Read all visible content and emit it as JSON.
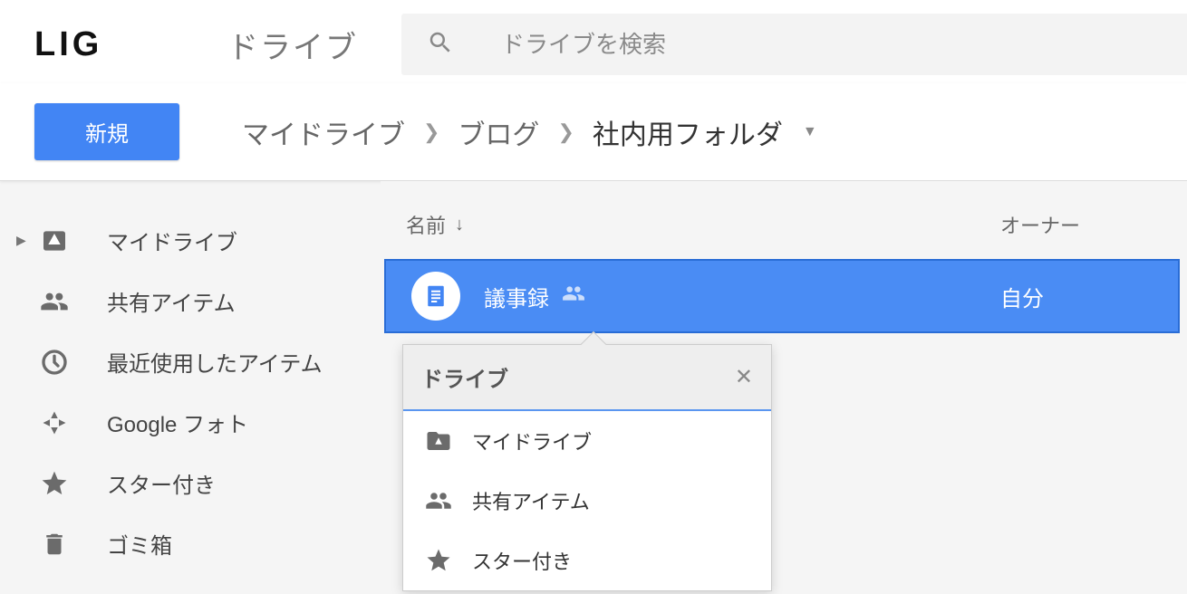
{
  "logo": "LIG",
  "app_name": "ドライブ",
  "search": {
    "placeholder": "ドライブを検索"
  },
  "new_button": "新規",
  "breadcrumb": [
    {
      "label": "マイドライブ"
    },
    {
      "label": "ブログ"
    },
    {
      "label": "社内用フォルダ",
      "current": true
    }
  ],
  "sidebar": {
    "items": [
      {
        "label": "マイドライブ",
        "icon": "drive",
        "expandable": true
      },
      {
        "label": "共有アイテム",
        "icon": "people"
      },
      {
        "label": "最近使用したアイテム",
        "icon": "clock"
      },
      {
        "label": "Google フォト",
        "icon": "photos"
      },
      {
        "label": "スター付き",
        "icon": "star"
      },
      {
        "label": "ゴミ箱",
        "icon": "trash"
      }
    ]
  },
  "columns": {
    "name": "名前",
    "owner": "オーナー"
  },
  "file": {
    "name": "議事録",
    "owner": "自分"
  },
  "popover": {
    "title": "ドライブ",
    "items": [
      {
        "label": "マイドライブ",
        "icon": "folder-drive"
      },
      {
        "label": "共有アイテム",
        "icon": "people"
      },
      {
        "label": "スター付き",
        "icon": "star"
      }
    ]
  }
}
